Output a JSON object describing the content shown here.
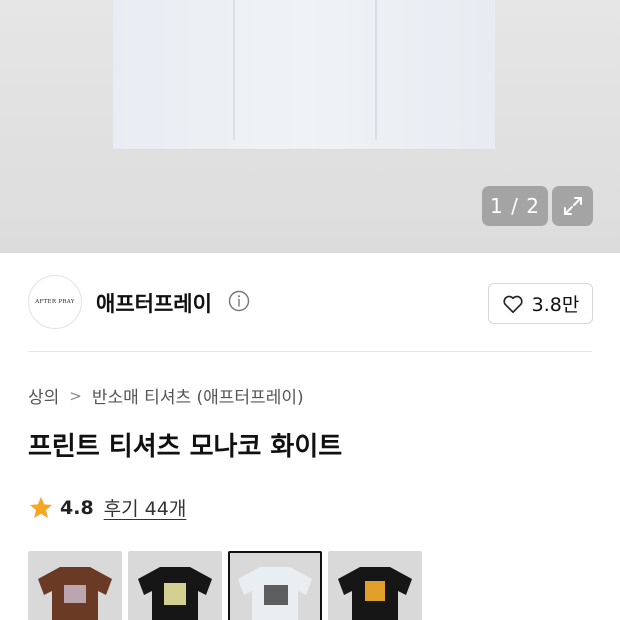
{
  "gallery": {
    "counter": "1 / 2",
    "expand_icon": "expand-arrows-icon"
  },
  "brand": {
    "logo_text": "AFTER PRAY",
    "name": "애프터프레이",
    "info_icon": "info-icon"
  },
  "like": {
    "icon": "heart-outline-icon",
    "count": "3.8만"
  },
  "breadcrumb": {
    "category": "상의",
    "separator": ">",
    "subcategory": "반소매 티셔츠 (애프터프레이)"
  },
  "product": {
    "title": "프린트 티셔츠 모나코 화이트"
  },
  "rating": {
    "icon": "star-icon",
    "score": "4.8",
    "reviews": "후기 44개",
    "star_color": "#f5a623"
  },
  "thumbnails": [
    {
      "color": "#6a3a25",
      "print": "#c9b8c8",
      "selected": false
    },
    {
      "color": "#161616",
      "print": "#e8e4a0",
      "selected": false
    },
    {
      "color": "#e9eef2",
      "print": "#3a3a3a",
      "selected": true
    },
    {
      "color": "#161616",
      "print": "#e0a02a",
      "selected": false
    }
  ]
}
